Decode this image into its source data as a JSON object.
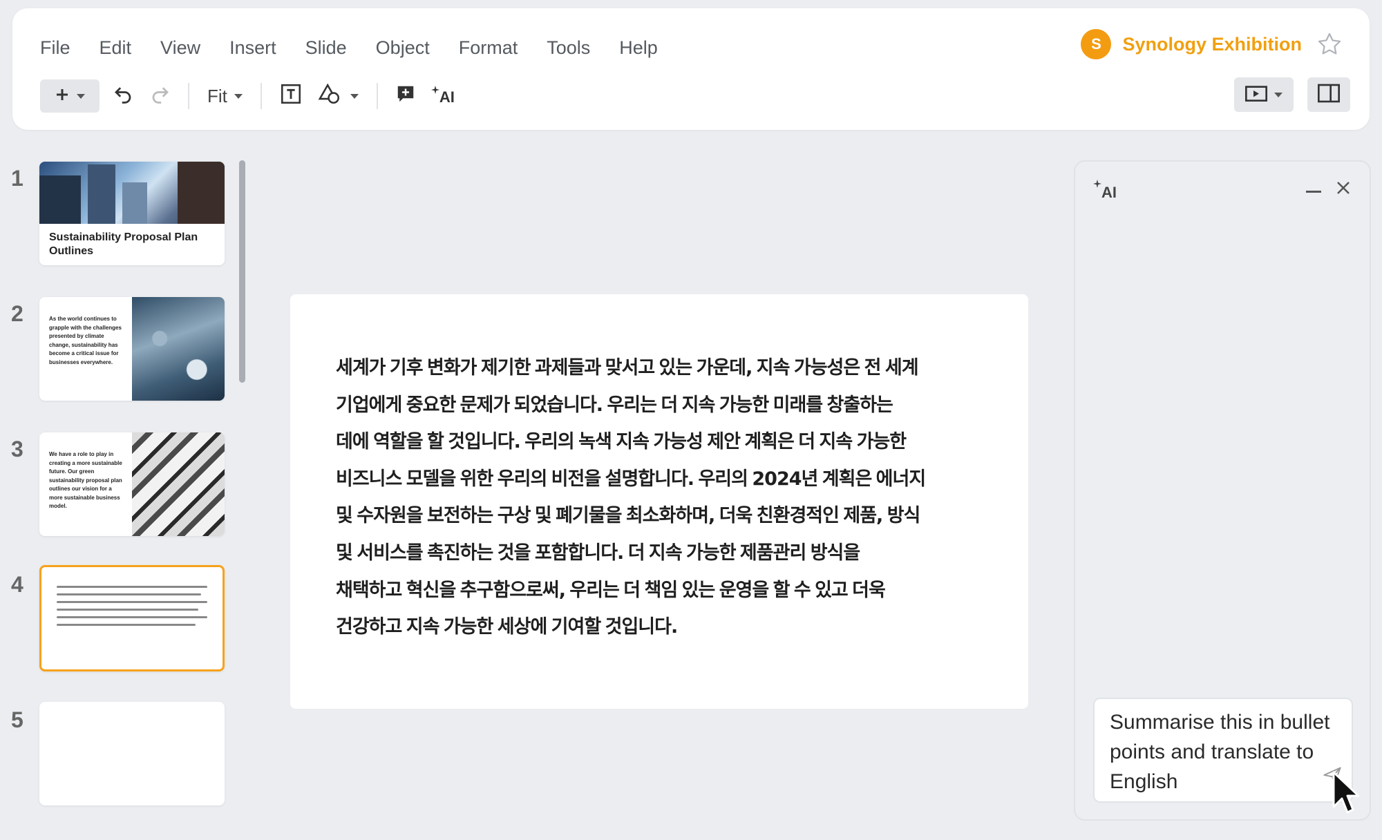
{
  "menu": [
    "File",
    "Edit",
    "View",
    "Insert",
    "Slide",
    "Object",
    "Format",
    "Tools",
    "Help"
  ],
  "brand": {
    "avatar_letter": "S",
    "name": "Synology Exhibition"
  },
  "toolbar": {
    "zoom_label": "Fit",
    "icons": [
      "plus-icon",
      "undo-icon",
      "redo-icon",
      "text-box-icon",
      "shapes-icon",
      "insert-comment-icon",
      "ai-magic-icon"
    ],
    "ai_label": "AI"
  },
  "slides": [
    {
      "number": "1",
      "title": "Sustainability Proposal Plan Outlines"
    },
    {
      "number": "2",
      "text": "As the world continues to grapple with the challenges presented by climate change, sustainability has become a critical issue for businesses everywhere."
    },
    {
      "number": "3",
      "text": "We have a role to play in creating a more sustainable future. Our green sustainability proposal plan outlines our vision for a more sustainable business model."
    },
    {
      "number": "4"
    },
    {
      "number": "5"
    }
  ],
  "current_slide": {
    "lines": [
      "세계가 기후 변화가 제기한 과제들과 맞서고 있는 가운데, 지속 가능성은 전 세계",
      "기업에게 중요한 문제가 되었습니다. 우리는 더 지속 가능한 미래를 창출하는",
      "데에 역할을 할 것입니다. 우리의 녹색 지속 가능성 제안 계획은 더 지속 가능한",
      "비즈니스 모델을 위한 우리의 비전을 설명합니다. 우리의 2024년 계획은 에너지",
      "및 수자원을 보전하는 구상 및 폐기물을 최소화하며, 더욱 친환경적인 제품, 방식",
      "및 서비스를 촉진하는 것을 포함합니다. 더 지속 가능한 제품관리 방식을",
      "채택하고 혁신을 추구함으로써, 우리는 더 책임 있는 운영을 할 수 있고 더욱",
      "건강하고 지속 가능한 세상에 기여할 것입니다."
    ]
  },
  "ai_panel": {
    "label": "AI",
    "prompt": "Summarise this in bullet points and translate to English"
  },
  "colors": {
    "accent": "#f0a011",
    "selection": "#f7a21b",
    "background": "#ebedf0"
  }
}
